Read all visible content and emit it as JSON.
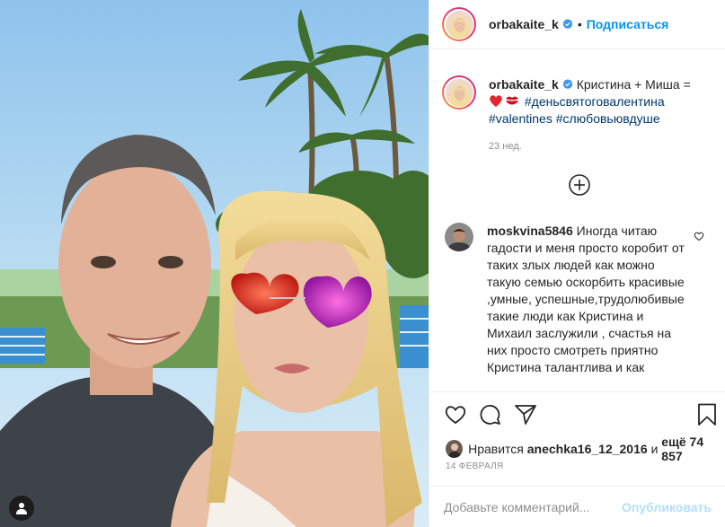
{
  "post": {
    "username": "orbakaite_k",
    "separator": "•",
    "follow_label": "Подписаться"
  },
  "caption": {
    "username": "orbakaite_k",
    "text": "Кристина + Миша =",
    "hashtag1": "#деньсвятоговалентина",
    "hashtag2": "#valentines",
    "hashtag3": "#слюбовьювдуше",
    "time": "23 нед.",
    "emoji": [
      "red-heart-emoji",
      "kiss-mark-emoji"
    ]
  },
  "comment": {
    "username": "moskvina5846",
    "text": "Иногда читаю гадости и меня просто коробит от таких злых людей как можно такую семью оскорбить красивые ,умные, успешные,трудолюбивые такие люди как Кристина и Михаил заслужили , счастья на них просто смотреть приятно Кристина талантлива и как"
  },
  "likes": {
    "prefix": "Нравится",
    "liker": "anechka16_12_2016",
    "and": "и",
    "more": "ещё 74 857"
  },
  "date": "14 ФЕВРАЛЯ",
  "add_comment": {
    "placeholder": "Добавьте комментарий...",
    "publish_label": "Опубликовать"
  },
  "colors": {
    "link_blue": "#0095f6",
    "hashtag": "#00376b",
    "publish_disabled": "#b2dffc",
    "secondary_text": "#8e8e8e"
  }
}
